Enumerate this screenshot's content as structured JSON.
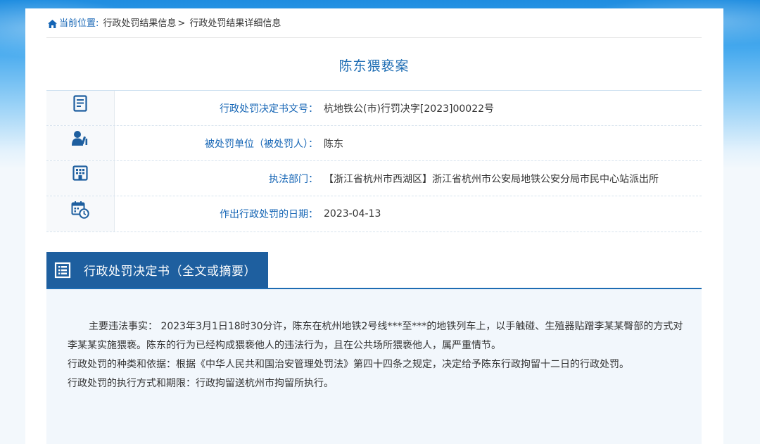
{
  "breadcrumb": {
    "label": "当前位置",
    "colon": ":",
    "items": [
      "行政处罚结果信息",
      "行政处罚结果详细信息"
    ],
    "separator": ">"
  },
  "case": {
    "title": "陈东猥亵案"
  },
  "details": [
    {
      "icon": "document-icon",
      "label": "行政处罚决定书文号",
      "value": "杭地铁公(市)行罚决字[2023]00022号"
    },
    {
      "icon": "person-icon",
      "label": "被处罚单位（被处罚人）",
      "value": "陈东"
    },
    {
      "icon": "building-icon",
      "label": "执法部门",
      "value": "【浙江省杭州市西湖区】浙江省杭州市公安局地铁公安分局市民中心站派出所"
    },
    {
      "icon": "calendar-clock-icon",
      "label": "作出行政处罚的日期",
      "value": "2023-04-13"
    }
  ],
  "label_suffix": "：",
  "section": {
    "title": "行政处罚决定书（全文或摘要）",
    "icon": "document-list-icon"
  },
  "content": {
    "facts": "主要违法事实： 2023年3月1日18时30分许，陈东在杭州地铁2号线***至***的地铁列车上，以手触碰、生殖器贴蹭李某某臀部的方式对李某某实施猥亵。陈东的行为已经构成猥亵他人的违法行为，且在公共场所猥亵他人，属严重情节。",
    "basis": "行政处罚的种类和依据：根据《中华人民共和国治安管理处罚法》第四十四条之规定，决定给予陈东行政拘留十二日的行政处罚。",
    "execution": "行政处罚的执行方式和期限：行政拘留送杭州市拘留所执行。"
  },
  "colors": {
    "accent": "#1d6cb3",
    "tab_bg": "#1e5f9f",
    "content_bg": "#f2f7fc"
  }
}
